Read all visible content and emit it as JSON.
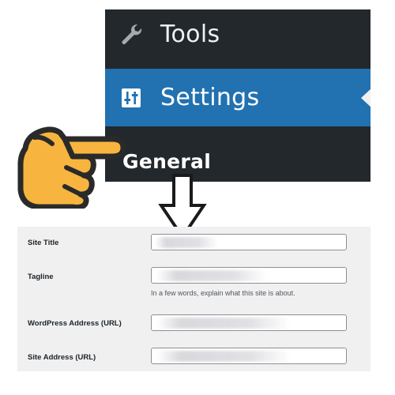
{
  "sidebar": {
    "items": [
      {
        "label": "Tools",
        "icon": "wrench-icon"
      },
      {
        "label": "Settings",
        "icon": "settings-sliders-icon",
        "active": true
      },
      {
        "label": "General",
        "icon": "",
        "submenu": true
      }
    ],
    "colors": {
      "background": "#23282d",
      "active": "#2271b1",
      "text": "#f0f0f1"
    }
  },
  "annotations": {
    "pointer": "pointing-hand-icon",
    "arrow": "down-arrow-icon",
    "hand_color": "#f7b53f"
  },
  "form": {
    "fields": [
      {
        "label": "Site Title",
        "value": ""
      },
      {
        "label": "Tagline",
        "value": "",
        "description": "In a few words, explain what this site is about."
      },
      {
        "label": "WordPress Address (URL)",
        "value": ""
      },
      {
        "label": "Site Address (URL)",
        "value": ""
      }
    ]
  }
}
